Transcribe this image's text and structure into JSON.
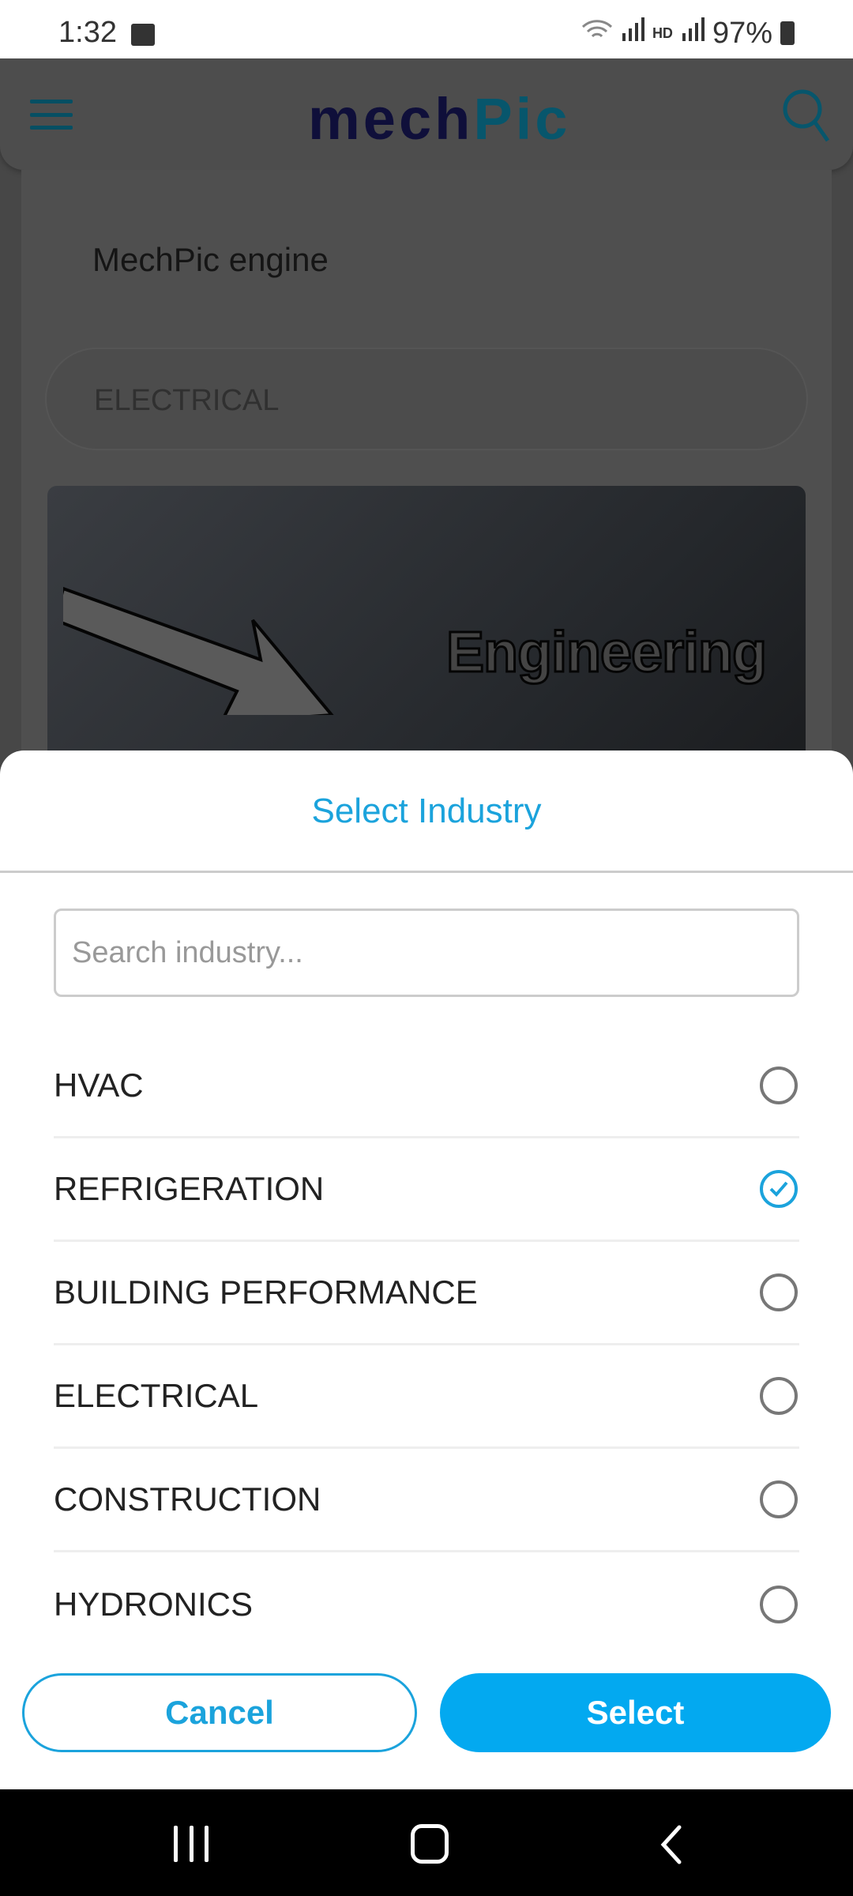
{
  "status_bar": {
    "time": "1:32",
    "battery": "97%",
    "network_label": "HD"
  },
  "header": {
    "logo_part1": "mech",
    "logo_part2": "Pic",
    "logo_full": "MechPic"
  },
  "background": {
    "card_title": "MechPic engine",
    "industry_value": "ELECTRICAL",
    "hero_text": "Engineering"
  },
  "sheet": {
    "title": "Select Industry",
    "search_placeholder": "Search industry...",
    "items": [
      {
        "label": "HVAC",
        "selected": false
      },
      {
        "label": "REFRIGERATION",
        "selected": true
      },
      {
        "label": "BUILDING PERFORMANCE",
        "selected": false
      },
      {
        "label": "ELECTRICAL",
        "selected": false
      },
      {
        "label": "CONSTRUCTION",
        "selected": false
      },
      {
        "label": "HYDRONICS",
        "selected": false
      }
    ],
    "cancel_label": "Cancel",
    "select_label": "Select"
  },
  "colors": {
    "accent": "#03a9f0",
    "title": "#1ba3dc",
    "logo_dark": "#111150",
    "logo_teal": "#0a90b5"
  }
}
